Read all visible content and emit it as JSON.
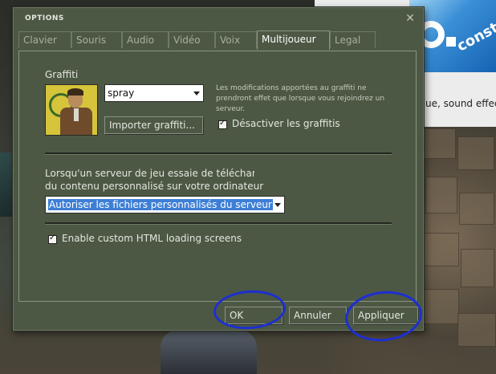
{
  "background": {
    "snippet_text": "ue, sound effects",
    "banner_word": "constru"
  },
  "dialog": {
    "title": "OPTIONS",
    "close_glyph": "✕",
    "tabs": [
      {
        "label": "Clavier",
        "active": false
      },
      {
        "label": "Souris",
        "active": false
      },
      {
        "label": "Audio",
        "active": false
      },
      {
        "label": "Vidéo",
        "active": false
      },
      {
        "label": "Voix",
        "active": false
      },
      {
        "label": "Multijoueur",
        "active": true
      },
      {
        "label": "Legal",
        "active": false
      }
    ],
    "graffiti": {
      "section_label": "Graffiti",
      "spray_select_value": "spray",
      "import_button": "Importer graffiti...",
      "note": "Les modifications apportées au graffiti ne prendront effet que lorsque vous rejoindrez un serveur.",
      "disable_checkbox_label": "Désactiver les graffitis",
      "disable_checked": true
    },
    "custom_content": {
      "line1": "Lorsqu'un serveur de jeu essaie de télécharge",
      "line2": "du contenu personnalisé sur votre ordinateur",
      "select_value": "Autoriser les fichiers personnalisés du serveur"
    },
    "html_loading": {
      "checkbox_label": "Enable custom HTML loading screens",
      "checked": true
    },
    "buttons": {
      "ok": "OK",
      "cancel": "Annuler",
      "apply": "Appliquer"
    }
  },
  "colors": {
    "dialog_bg": "#4c5844",
    "annotation": "#1d2fd0",
    "selection": "#3d7fd6"
  }
}
